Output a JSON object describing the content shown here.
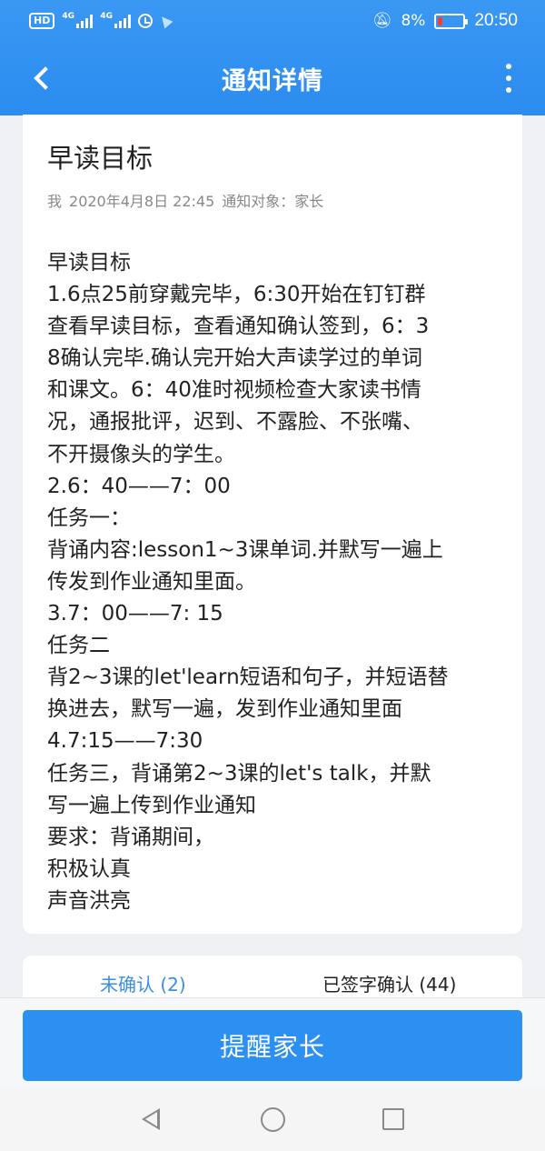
{
  "status_bar": {
    "hd_badge": "HD",
    "net_1": "4G",
    "net_2": "4G",
    "battery_percent": "8%",
    "time": "20:50"
  },
  "app_bar": {
    "title": "通知详情"
  },
  "notice": {
    "title": "早读目标",
    "sender": "我",
    "datetime": "2020年4月8日 22:45",
    "audience": "通知对象：家长",
    "body_lines": [
      "早读目标",
      "1.6点25前穿戴完毕，6:30开始在钉钉群",
      "查看早读目标，查看通知确认签到，6：3",
      "8确认完毕.确认完开始大声读学过的单词",
      "和课文。6：40准时视频检查大家读书情",
      "况，通报批评，迟到、不露脸、不张嘴、",
      "不开摄像头的学生。",
      "2.6：40——7：00",
      "任务一：",
      "背诵内容:lesson1~3课单词.并默写一遍上",
      "传发到作业通知里面。",
      "3.7：00——7: 15",
      "任务二",
      "背2~3课的let'learn短语和句子，并短语替",
      "换进去，默写一遍，发到作业通知里面",
      "4.7:15——7:30",
      "任务三，背诵第2~3课的let's talk，并默",
      "写一遍上传到作业通知",
      "要求：背诵期间，",
      "积极认真",
      "声音洪亮"
    ]
  },
  "confirm_tabs": {
    "unconfirmed": "未确认 (2)",
    "confirmed": "已签字确认 (44)"
  },
  "actions": {
    "remind_label": "提醒家长"
  },
  "colors": {
    "header_blue": "#2b8cf0",
    "button_blue": "#2c8ff2",
    "tab_active": "#3a8ee6"
  }
}
